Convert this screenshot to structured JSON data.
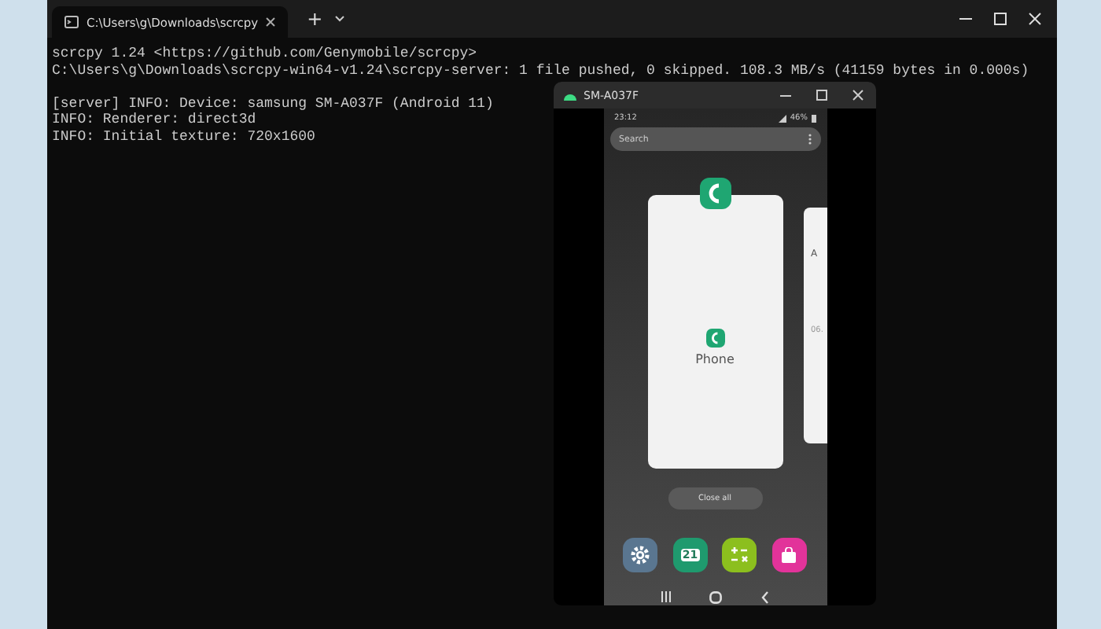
{
  "terminal": {
    "tab": {
      "title": "C:\\Users\\g\\Downloads\\scrcpy",
      "selected": true
    },
    "new_tab": "+",
    "blocks": [
      [
        "scrcpy 1.24 <https://github.com/Genymobile/scrcpy>",
        "C:\\Users\\g\\Downloads\\scrcpy-win64-v1.24\\scrcpy-server: 1 file pushed, 0 skipped. 108.3 MB/s (41159 bytes in 0.000s)"
      ],
      [
        "[server] INFO: Device: samsung SM-A037F (Android 11)",
        "INFO: Renderer: direct3d",
        "INFO: Initial texture: 720x1600"
      ]
    ]
  },
  "mirror": {
    "title": "SM-A037F",
    "status_bar": {
      "time": "23:12",
      "battery": "46%"
    },
    "search": {
      "placeholder": "Search"
    },
    "app_card": {
      "label": "Phone"
    },
    "side_card": {
      "texts": [
        "A",
        "06."
      ]
    },
    "close_all": "Close all",
    "dock": [
      {
        "kind": "settings"
      },
      {
        "kind": "calendar",
        "text": "21"
      },
      {
        "kind": "calculator"
      },
      {
        "kind": "store"
      }
    ]
  }
}
